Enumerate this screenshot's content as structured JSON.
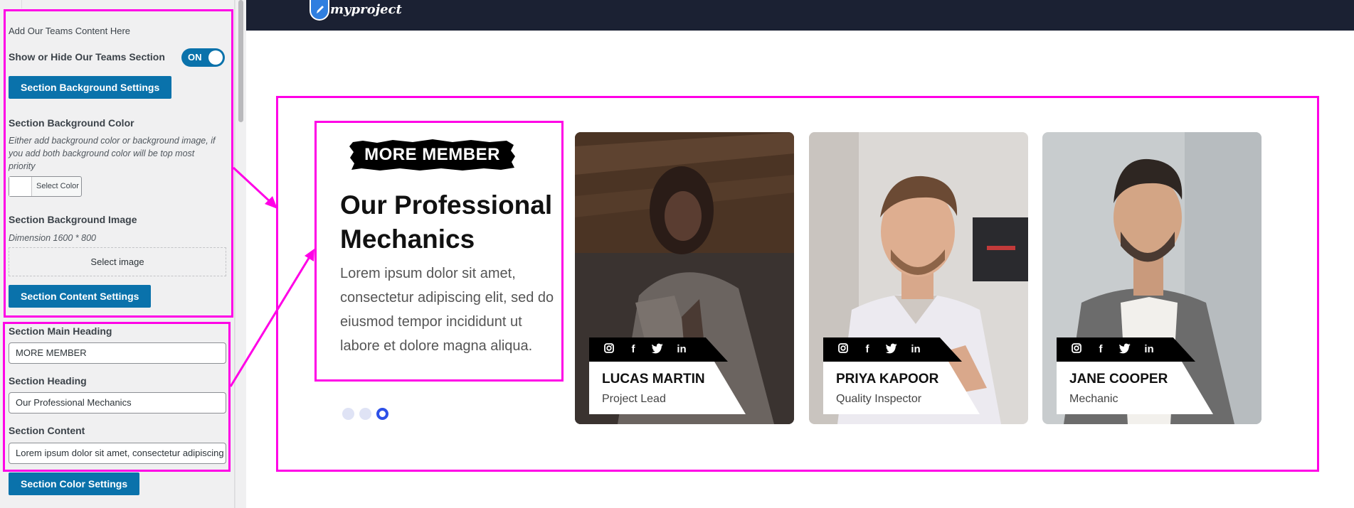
{
  "sidebar": {
    "intro_text": "Add Our Teams Content Here",
    "show_hide_label": "Show or Hide Our Teams Section",
    "toggle_state": "ON",
    "bg_settings_button": "Section Background Settings",
    "bg_color_label": "Section Background Color",
    "bg_color_desc": "Either add background color or background image, if you add both background color will be top most priority",
    "select_color_button": "Select Color",
    "bg_image_label": "Section Background Image",
    "bg_image_dimension": "Dimension 1600 * 800",
    "select_image_button": "Select image",
    "content_settings_button": "Section Content Settings",
    "main_heading_label": "Section Main Heading",
    "main_heading_value": "MORE MEMBER",
    "heading_label": "Section Heading",
    "heading_value": "Our Professional Mechanics",
    "content_label": "Section Content",
    "content_value": "Lorem ipsum dolor sit amet, consectetur adipiscing elit, sed do eiusmod tempor incididunt ut labore et dolore magna aliqua.",
    "color_settings_button": "Section Color Settings"
  },
  "header": {
    "logo_text": "myproject"
  },
  "teams": {
    "tag": "MORE MEMBER",
    "heading": "Our Professional Mechanics",
    "content": "Lorem ipsum dolor sit amet, consectetur adipiscing elit, sed do eiusmod tempor incididunt ut labore et dolore magna aliqua.",
    "slider_dots": 3,
    "active_dot": 3,
    "social_icons": [
      "instagram-icon",
      "facebook-icon",
      "twitter-icon",
      "linkedin-icon"
    ],
    "members": [
      {
        "name": "LUCAS MARTIN",
        "role": "Project Lead"
      },
      {
        "name": "PRIYA KAPOOR",
        "role": "Quality Inspector"
      },
      {
        "name": "JANE COOPER",
        "role": "Mechanic"
      }
    ]
  },
  "colors": {
    "annotation": "#ff00e6",
    "wp_button": "#0a72ab",
    "topbar": "#1b2133",
    "dot_active": "#2d50e8"
  }
}
